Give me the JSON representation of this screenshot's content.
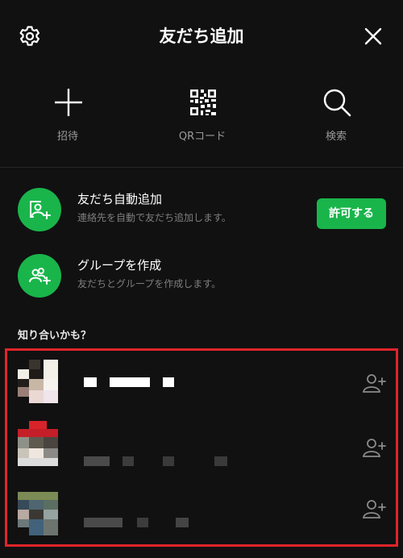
{
  "header": {
    "title": "友だち追加",
    "settings_icon": "gear-icon",
    "close_icon": "close-icon"
  },
  "actions": [
    {
      "label": "招待",
      "icon": "plus-icon"
    },
    {
      "label": "QRコード",
      "icon": "qr-code-icon"
    },
    {
      "label": "検索",
      "icon": "search-icon"
    }
  ],
  "auto_add": {
    "title": "友だち自動追加",
    "description": "連絡先を自動で友だち追加します。",
    "button_label": "許可する",
    "icon": "add-contact-icon"
  },
  "create_group": {
    "title": "グループを作成",
    "description": "友だちとグループを作成します。",
    "icon": "add-group-icon"
  },
  "suggestions": {
    "title": "知り合いかも？",
    "items_icon": "add-friend-icon"
  },
  "colors": {
    "background": "#111111",
    "accent_green": "#19b54b",
    "highlight_red": "#e0242a",
    "secondary_text": "#9a9a9a"
  }
}
